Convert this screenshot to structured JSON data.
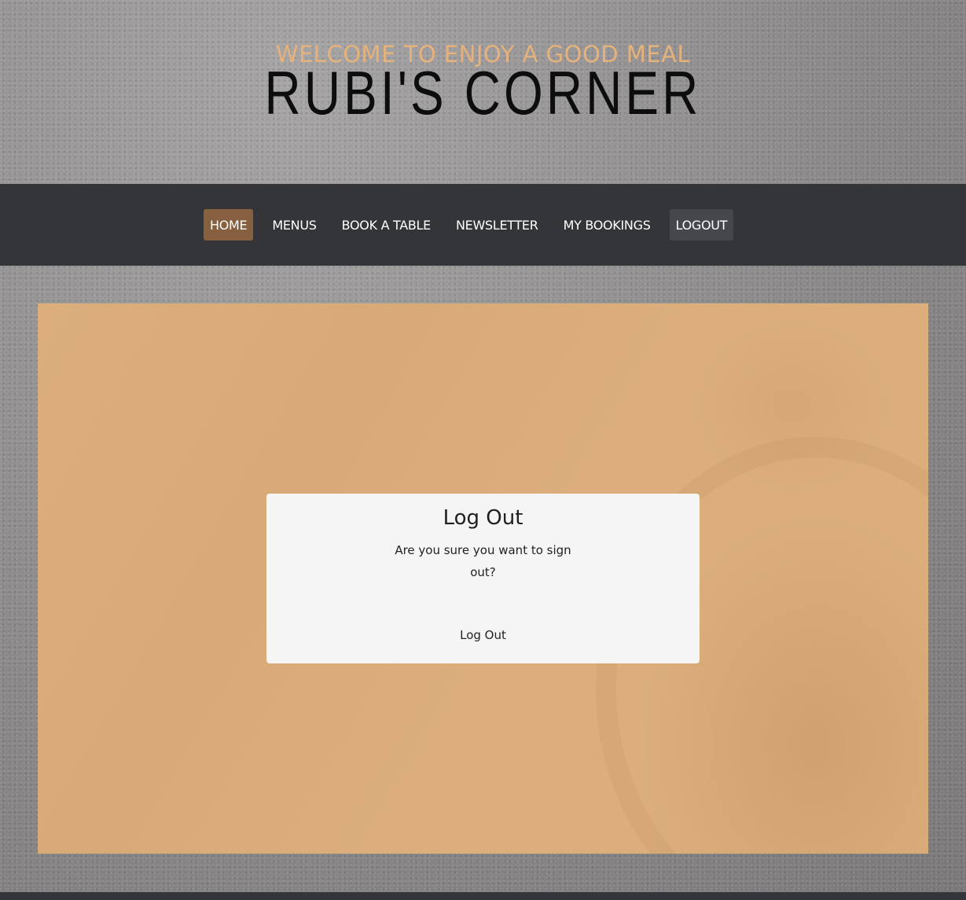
{
  "header": {
    "tagline": "WELCOME TO ENJOY A GOOD MEAL",
    "brand": "RUBI'S CORNER"
  },
  "nav": {
    "items": [
      {
        "label": "HOME",
        "active": true
      },
      {
        "label": "MENUS"
      },
      {
        "label": "BOOK A TABLE"
      },
      {
        "label": "NEWSLETTER"
      },
      {
        "label": "MY BOOKINGS"
      },
      {
        "label": "LOGOUT",
        "current": true
      }
    ]
  },
  "main": {
    "card": {
      "title": "Log Out",
      "message": "Are you sure you want to sign out?",
      "button_label": "Log Out"
    }
  },
  "colors": {
    "accent": "#e6b27c",
    "navbar": "#343539",
    "home_active": "#86603f",
    "logout_current": "#45474c",
    "panel": "#dbae7c",
    "card": "#f5f5f5",
    "footer": "#343539"
  }
}
